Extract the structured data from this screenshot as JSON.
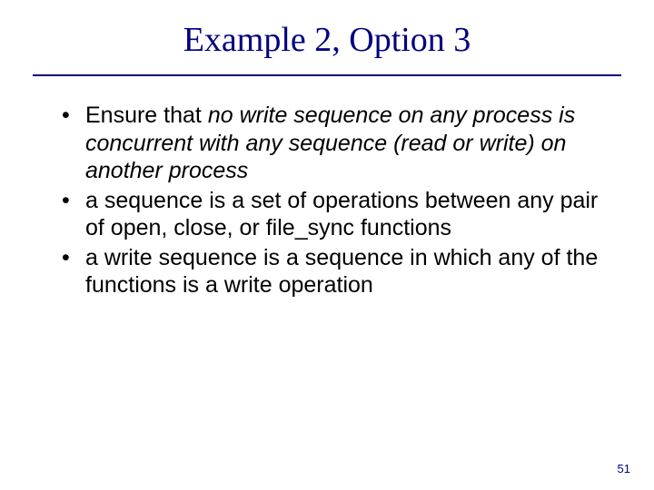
{
  "slide": {
    "title": "Example 2, Option 3",
    "bullets": [
      {
        "lead": "Ensure that ",
        "emph": "no write sequence on any process is concurrent with any sequence (read or write) on another process",
        "tail": ""
      },
      {
        "lead": "a sequence is a set of operations between any pair of open, close, or file_sync functions",
        "emph": "",
        "tail": ""
      },
      {
        "lead": "a write sequence is a sequence in which any of the functions is a write operation",
        "emph": "",
        "tail": ""
      }
    ],
    "page_number": "51"
  }
}
